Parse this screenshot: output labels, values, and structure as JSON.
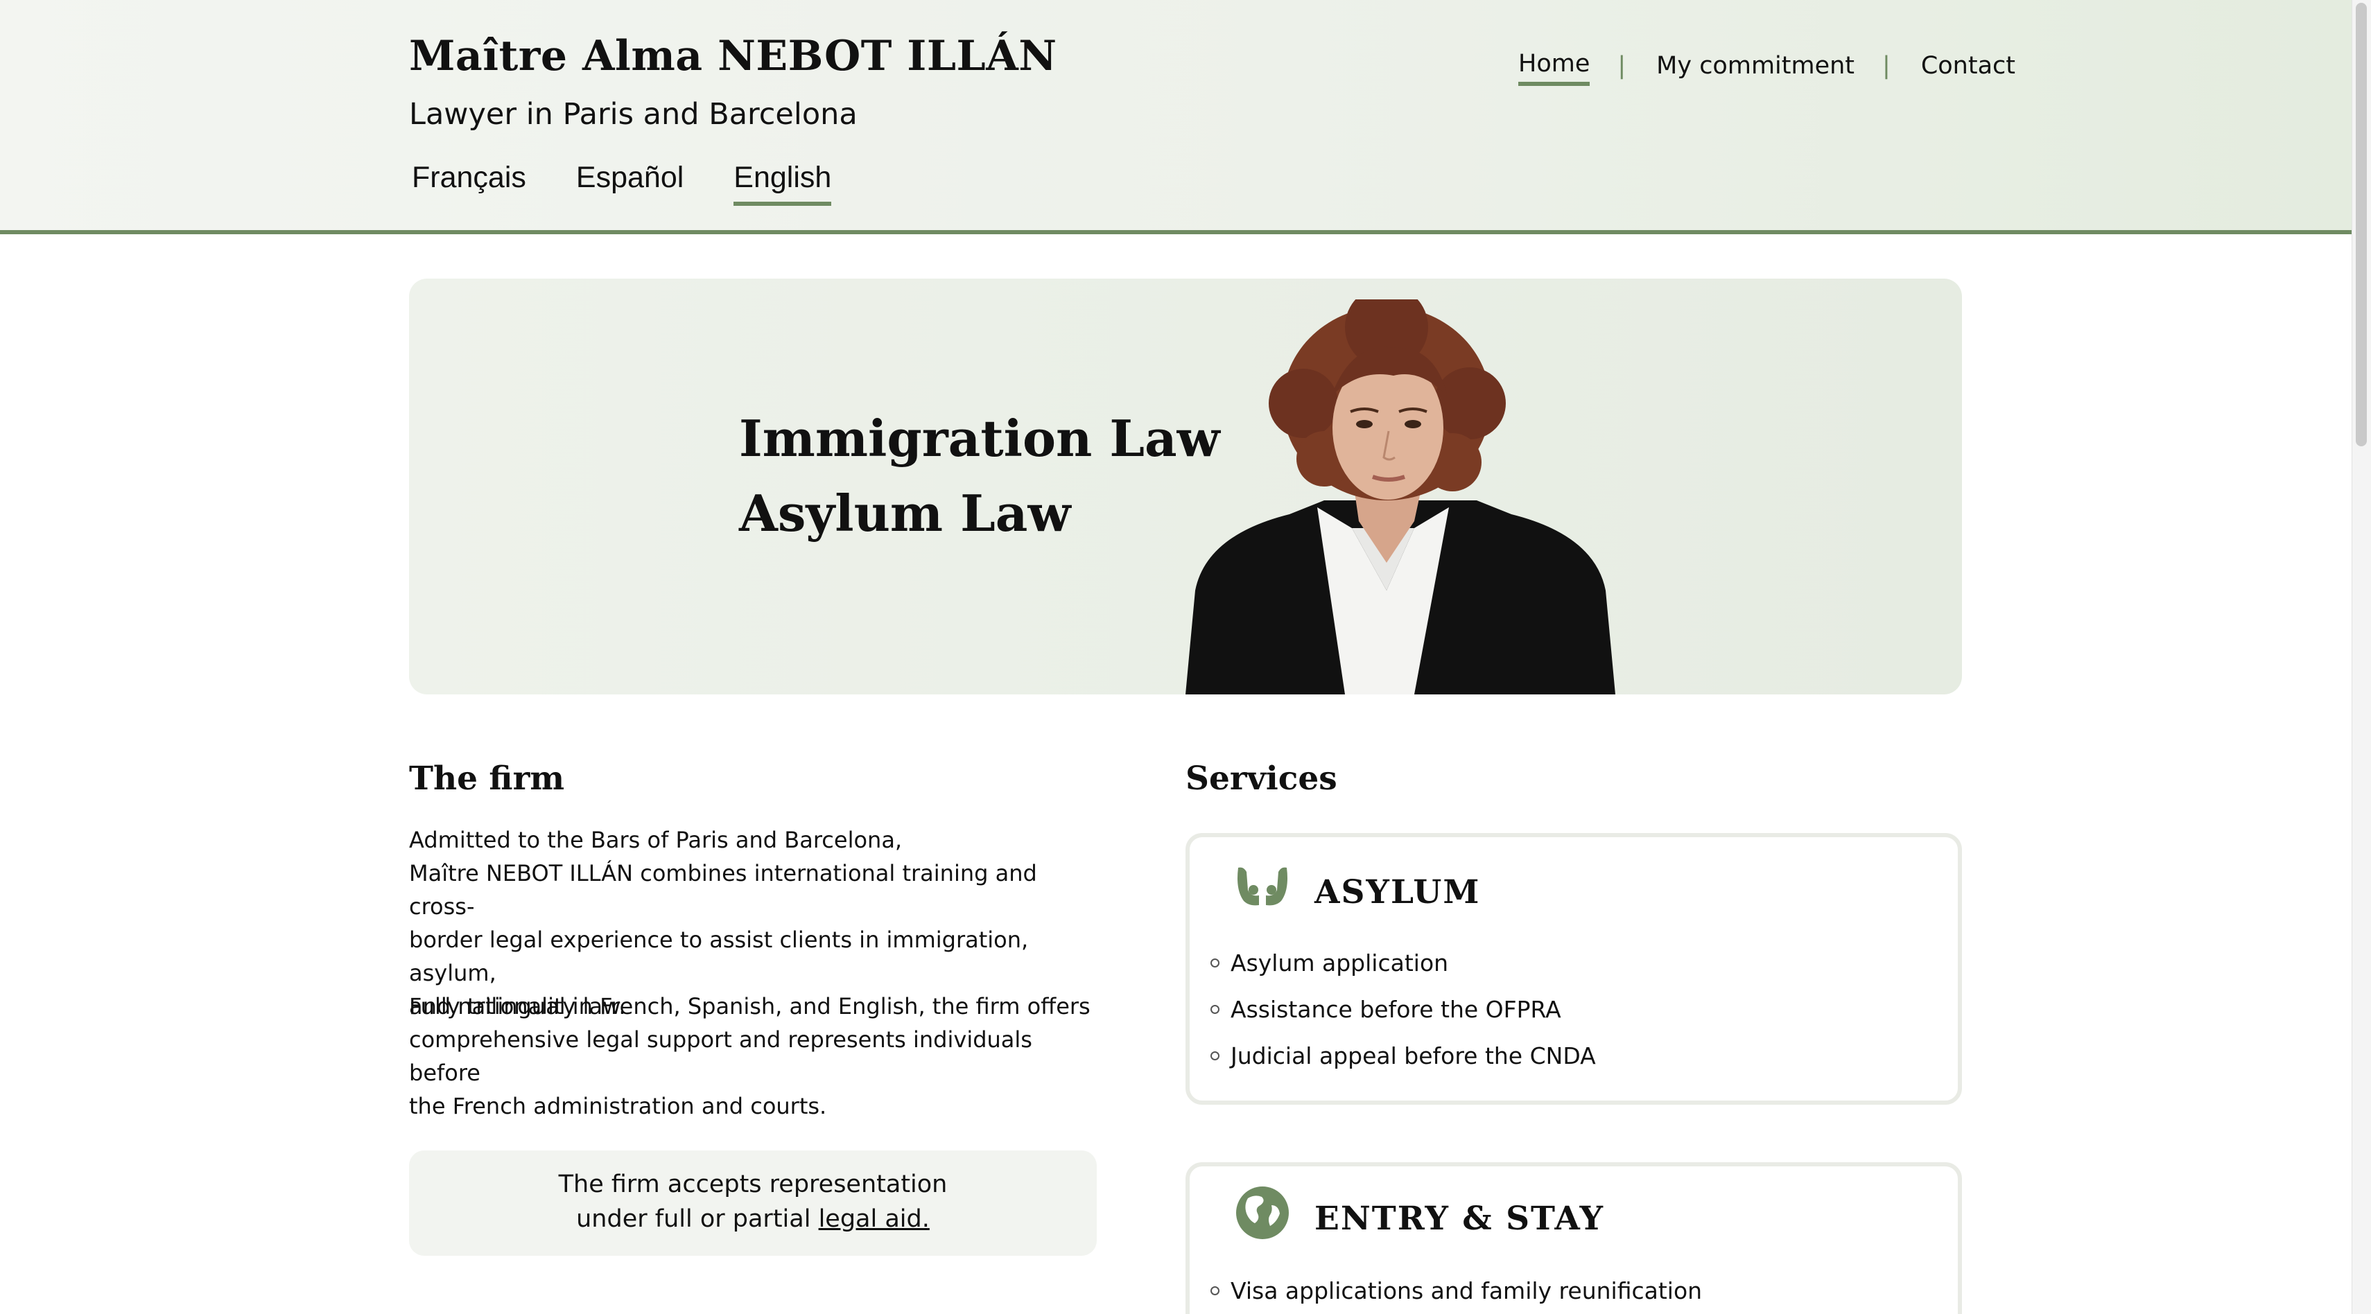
{
  "header": {
    "title": "Maître Alma NEBOT ILLÁN",
    "subtitle": "Lawyer in Paris and Barcelona",
    "languages": [
      {
        "label": "Français",
        "active": false
      },
      {
        "label": "Español",
        "active": false
      },
      {
        "label": "English",
        "active": true
      }
    ],
    "nav": [
      {
        "label": "Home",
        "active": true
      },
      {
        "label": "My commitment",
        "active": false
      },
      {
        "label": "Contact",
        "active": false
      }
    ],
    "nav_separator": "|"
  },
  "hero": {
    "lines": [
      "Immigration Law",
      "Asylum Law"
    ]
  },
  "firm": {
    "title": "The firm",
    "paragraph_1": "Admitted to the Bars of Paris and Barcelona, Maître NEBOT ILLÁN combines international training and cross-border legal experience to assist clients in immigration, asylum, and nationality law.",
    "paragraph_1_lines": [
      "Admitted to the Bars of Paris and Barcelona,",
      "Maître NEBOT ILLÁN combines international training and cross-",
      "border legal experience to assist clients in immigration, asylum,",
      "and nationality law."
    ],
    "paragraph_2_lines": [
      "Fully trilingual in French, Spanish, and English, the firm offers",
      "comprehensive legal support and represents individuals before",
      "the French administration and courts."
    ],
    "legal_aid": {
      "line_1": "The firm accepts representation",
      "line_2_prefix": "under full or partial ",
      "link": "legal aid."
    }
  },
  "services": {
    "title": "Services",
    "cards": [
      {
        "title": "ASYLUM",
        "icon": "hands-icon",
        "items": [
          "Asylum application",
          "Assistance before the OFPRA",
          "Judicial appeal before the CNDA"
        ]
      },
      {
        "title": "ENTRY & STAY",
        "icon": "globe-icon",
        "items": [
          "Visa applications and family reunification"
        ]
      }
    ]
  },
  "colors": {
    "accent": "#6f8b62",
    "header_bg": "#edf1ea",
    "hero_bg": "#e6ece2",
    "card_border": "#e9ebe5"
  }
}
